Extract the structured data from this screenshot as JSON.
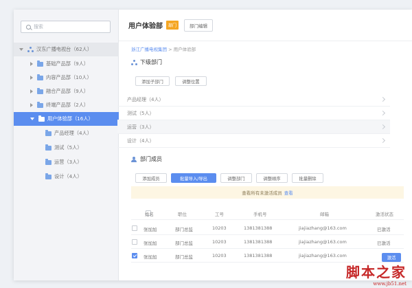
{
  "sidebar": {
    "search_placeholder": "搜索",
    "root": "汉东广播电视台（62人）",
    "items": [
      {
        "label": "基础产品部（9人）"
      },
      {
        "label": "内容产品部（10人）"
      },
      {
        "label": "融合产品部（9人）"
      },
      {
        "label": "终端产品部（2人）"
      },
      {
        "label": "用户体验部（16人）"
      }
    ],
    "children": [
      {
        "label": "产品经理（4人）"
      },
      {
        "label": "测试（5人）"
      },
      {
        "label": "运营（3人）"
      },
      {
        "label": "设计（4人）"
      }
    ]
  },
  "header": {
    "title": "用户体验部",
    "badge": "部门",
    "edit_button": "部门编辑"
  },
  "breadcrumb": {
    "root": "浙江广播电视集团",
    "sep": ">",
    "current": "用户体验部"
  },
  "subdepartments": {
    "title": "下级部门",
    "buttons": {
      "add": "添加子部门",
      "reorder": "调整位置"
    },
    "rows": [
      {
        "label": "产品经理（4人）"
      },
      {
        "label": "测试（5人）"
      },
      {
        "label": "运营（3人）"
      },
      {
        "label": "设计（4人）"
      }
    ]
  },
  "members": {
    "title": "部门成员",
    "buttons": {
      "add": "添加成员",
      "batch": "批量导入/导出",
      "dept": "调整部门",
      "order": "调整顺序",
      "delete": "批量删除"
    },
    "notice": {
      "text": "查看所有未激活成员",
      "link": "查看"
    },
    "columns": [
      "姓名",
      "职位",
      "工号",
      "手机号",
      "邮箱",
      "激活状态"
    ],
    "rows": [
      {
        "name": "张加加",
        "title": "部门总监",
        "id": "10203",
        "phone": "1381381388",
        "email": "jiajiazhang@163.com",
        "status": "已激活",
        "checked": false
      },
      {
        "name": "张加加",
        "title": "部门总监",
        "id": "10203",
        "phone": "1381381388",
        "email": "jiajiazhang@163.com",
        "status": "已激活",
        "checked": false
      },
      {
        "name": "张加加",
        "title": "部门总监",
        "id": "10203",
        "phone": "1381381388",
        "email": "jiajiazhang@163.com",
        "status": "激活",
        "checked": true
      }
    ]
  },
  "watermark": {
    "cn": "脚本之家",
    "url": "www.jb51.net"
  },
  "colors": {
    "accent": "#5b8def",
    "badge": "#f5a623",
    "watermark": "#c62828"
  }
}
